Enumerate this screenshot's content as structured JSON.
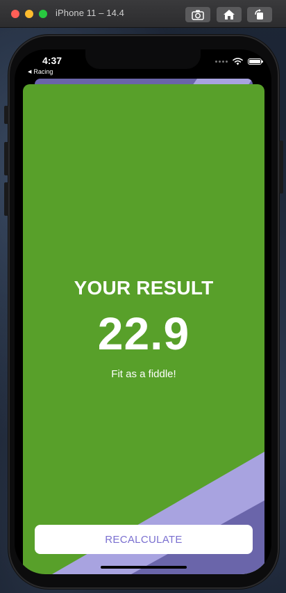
{
  "simulator": {
    "title": "iPhone 11 – 14.4",
    "buttons": [
      "screenshot-icon",
      "home-icon",
      "rotate-icon"
    ]
  },
  "status_bar": {
    "time": "4:37",
    "back_label": "Racing"
  },
  "result": {
    "title": "YOUR RESULT",
    "value": "22.9",
    "message": "Fit as a fiddle!"
  },
  "actions": {
    "recalculate_label": "RECALCULATE"
  },
  "colors": {
    "background_green": "#58a02a",
    "stripe_light": "#a8a3e0",
    "stripe_dark": "#6a65aa",
    "button_text": "#7a6fd0"
  }
}
